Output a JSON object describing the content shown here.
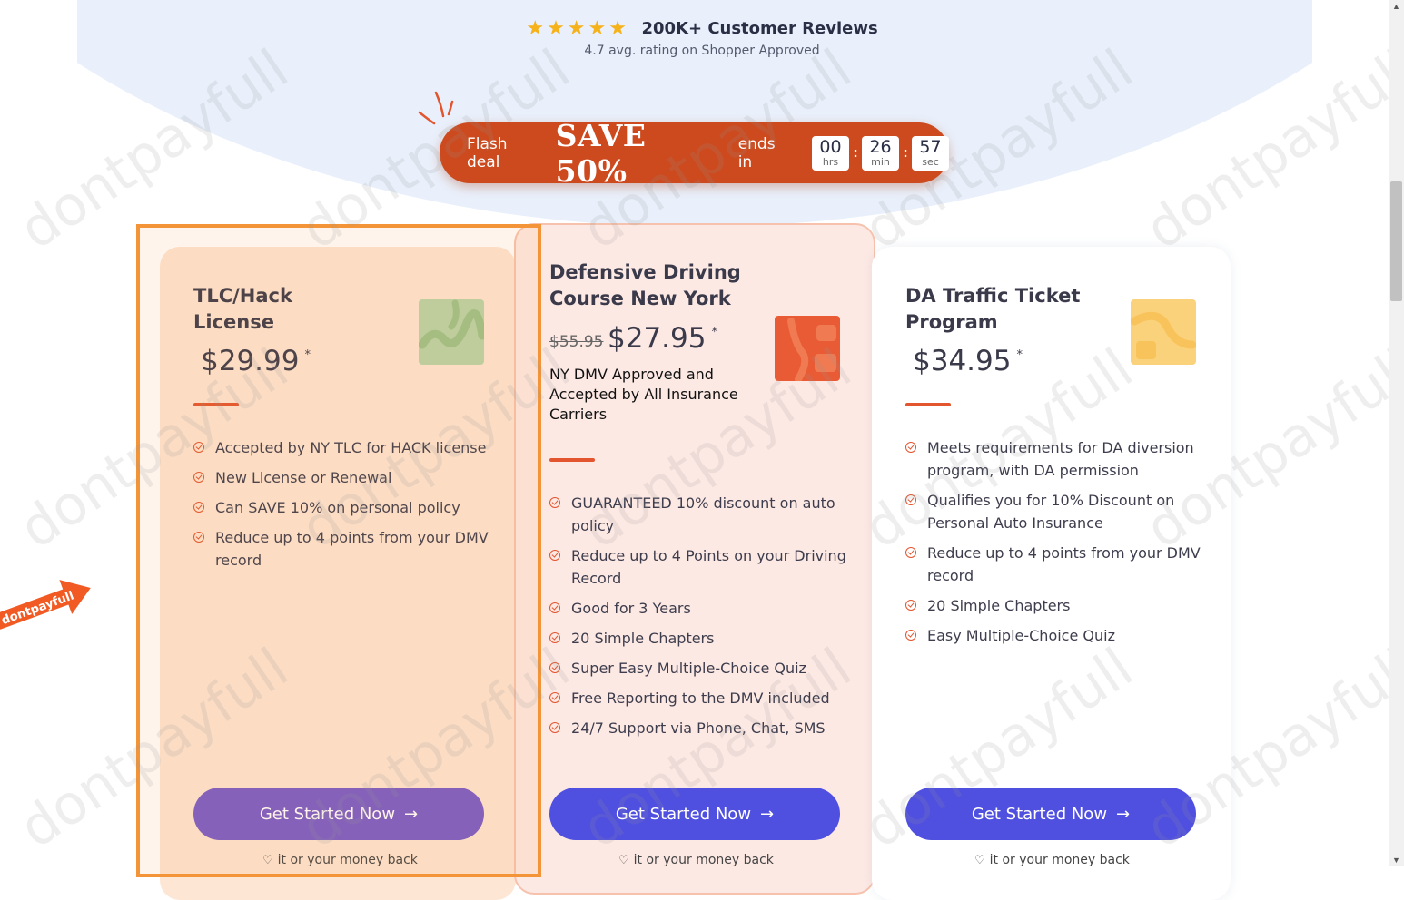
{
  "reviews": {
    "stars": 5,
    "title": "200K+ Customer Reviews",
    "subtitle": "4.7 avg. rating on Shopper Approved"
  },
  "flash": {
    "label": "Flash deal",
    "save": "SAVE 50%",
    "ends": "ends in",
    "hours": "00",
    "hours_unit": "hrs",
    "minutes": "26",
    "minutes_unit": "min",
    "seconds": "57",
    "seconds_unit": "sec"
  },
  "cards": [
    {
      "title_line1": "TLC/Hack",
      "title_line2": "License",
      "price": "$29.99",
      "asterisk": "*",
      "thumb_color": "#b9d4a8",
      "features": [
        "Accepted by NY TLC for HACK license",
        "New License or Renewal",
        "Can SAVE 10% on personal policy",
        "Reduce up to 4 points from your DMV record"
      ],
      "cta": "Get Started Now",
      "money_back": "it or your money back"
    },
    {
      "title_line1": "Defensive Driving",
      "title_line2": "Course New York",
      "old_price": "$55.95",
      "price": "$27.95",
      "asterisk": "*",
      "tagline": "NY DMV Approved and Accepted by All Insurance Carriers",
      "thumb_color": "#e95b35",
      "features": [
        "GUARANTEED 10% discount on auto policy",
        "Reduce up to 4 Points on your Driving Record",
        "Good for 3 Years",
        "20 Simple Chapters",
        "Super Easy Multiple-Choice Quiz",
        "Free Reporting to the DMV included",
        "24/7 Support via Phone, Chat, SMS"
      ],
      "cta": "Get Started Now",
      "money_back": "it or your money back"
    },
    {
      "title_line1": "DA Traffic Ticket",
      "title_line2": "Program",
      "price": "$34.95",
      "asterisk": "*",
      "thumb_color": "#fbd27c",
      "features": [
        "Meets requirements for DA diversion program, with DA permission",
        "Qualifies you for 10% Discount on Personal Auto Insurance",
        "Reduce up to 4 points from your DMV record",
        "20 Simple Chapters",
        "Easy Multiple-Choice Quiz"
      ],
      "cta": "Get Started Now",
      "money_back": "it or your money back"
    }
  ],
  "watermark": "dontpayfull",
  "tag_label": "dontpayfull",
  "colors": {
    "accent_orange": "#e2552e",
    "flash_bg": "#cc4a1e",
    "button_purple": "#7a5cc8",
    "button_blue": "#4f4fe0",
    "highlight_frame": "#f29437"
  }
}
